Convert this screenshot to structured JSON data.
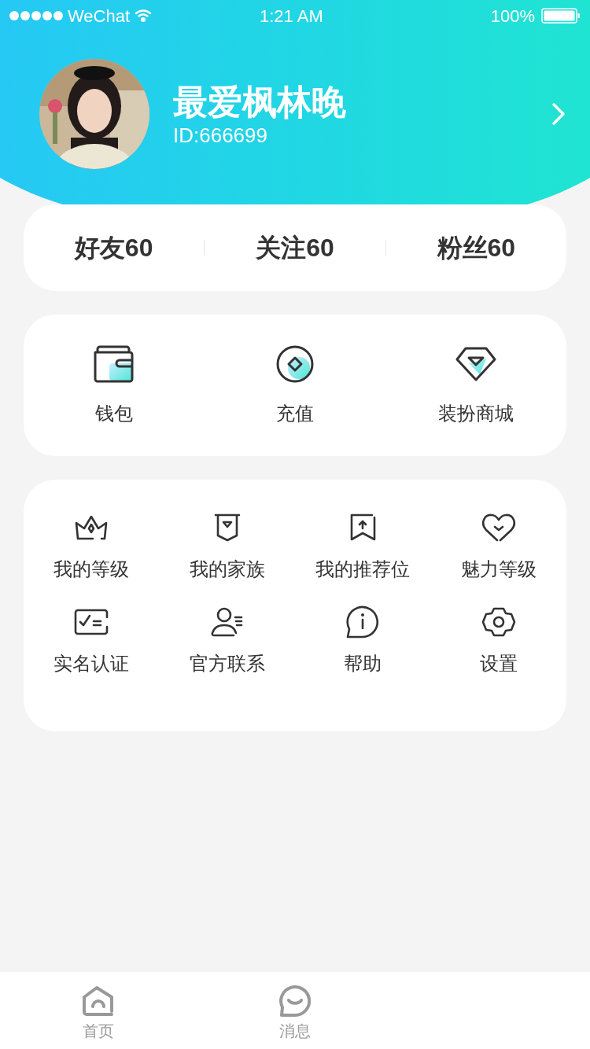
{
  "status_bar": {
    "carrier": "WeChat",
    "time": "1:21 AM",
    "battery": "100%"
  },
  "profile": {
    "name": "最爱枫林晚",
    "id": "ID:666699"
  },
  "stats": [
    {
      "label": "好友60"
    },
    {
      "label": "关注60"
    },
    {
      "label": "粉丝60"
    }
  ],
  "wallet_menu": [
    {
      "label": "钱包"
    },
    {
      "label": "充值"
    },
    {
      "label": "装扮商城"
    }
  ],
  "feature_menu": [
    {
      "label": "我的等级"
    },
    {
      "label": "我的家族"
    },
    {
      "label": "我的推荐位"
    },
    {
      "label": "魅力等级"
    },
    {
      "label": "实名认证"
    },
    {
      "label": "官方联系"
    },
    {
      "label": "帮助"
    },
    {
      "label": "设置"
    }
  ],
  "tab_bar": [
    {
      "label": "首页",
      "selected": false
    },
    {
      "label": "消息",
      "selected": false
    }
  ]
}
